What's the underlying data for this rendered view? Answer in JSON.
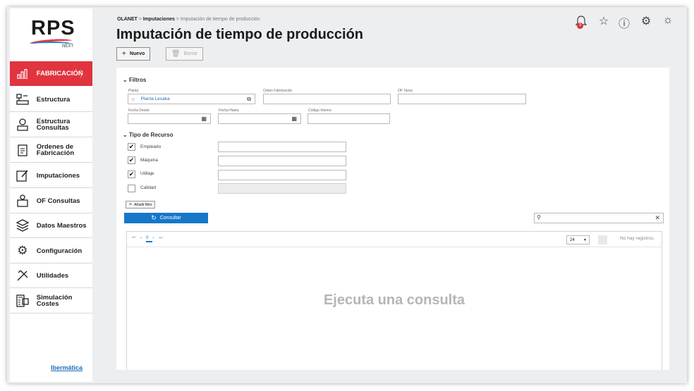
{
  "sidebar": {
    "logo_text": "RPS",
    "logo_sub": "NEXT",
    "items": [
      {
        "label": "FABRICACIÓN",
        "icon": "bar-chart-icon"
      },
      {
        "label": "Estructura",
        "icon": "structure-icon"
      },
      {
        "label": "Estructura\nConsultas",
        "icon": "structure-query-icon"
      },
      {
        "label": "Ordenes de\nFabricación",
        "icon": "clipboard-icon"
      },
      {
        "label": "Imputaciones",
        "icon": "edit-icon"
      },
      {
        "label": "OF Consultas",
        "icon": "package-icon"
      },
      {
        "label": "Datos Maestros",
        "icon": "layers-icon"
      },
      {
        "label": "Configuración",
        "icon": "gear-icon"
      },
      {
        "label": "Utilidades",
        "icon": "tools-icon"
      },
      {
        "label": "Simulación\nCostes",
        "icon": "calculator-icon"
      }
    ],
    "brand": "Ibermática"
  },
  "header": {
    "breadcrumb": {
      "root": "OLANET",
      "section": "Imputaciones",
      "current": "Imputación de tiempo de producción"
    },
    "title": "Imputación de tiempo de producción",
    "buttons": {
      "new": "Nuevo",
      "delete": "Borrar"
    },
    "notification_count": "3"
  },
  "filters": {
    "title": "Filtros",
    "planta_label": "Planta",
    "planta_value": "Planta Lesaka",
    "orden_label": "Orden Fabricación",
    "of_tarea_label": "OF Tarea",
    "fecha_desde_label": "Fecha Desde",
    "fecha_hasta_label": "Fecha Hasta",
    "codigo_label": "Código Interno",
    "resource_title": "Tipo de Recurso",
    "resources": [
      {
        "label": "Empleado",
        "checked": true
      },
      {
        "label": "Máquina",
        "checked": true
      },
      {
        "label": "Utillaje",
        "checked": true
      },
      {
        "label": "Calidad",
        "checked": false
      }
    ],
    "add_filter": "Añadir filtro",
    "consultar": "Consultar"
  },
  "grid": {
    "current_page": "0",
    "page_size": "24",
    "no_records": "No hay registros.",
    "empty_message": "Ejecuta una consulta"
  },
  "colors": {
    "accent": "#e0343f",
    "primary": "#1677c9"
  }
}
